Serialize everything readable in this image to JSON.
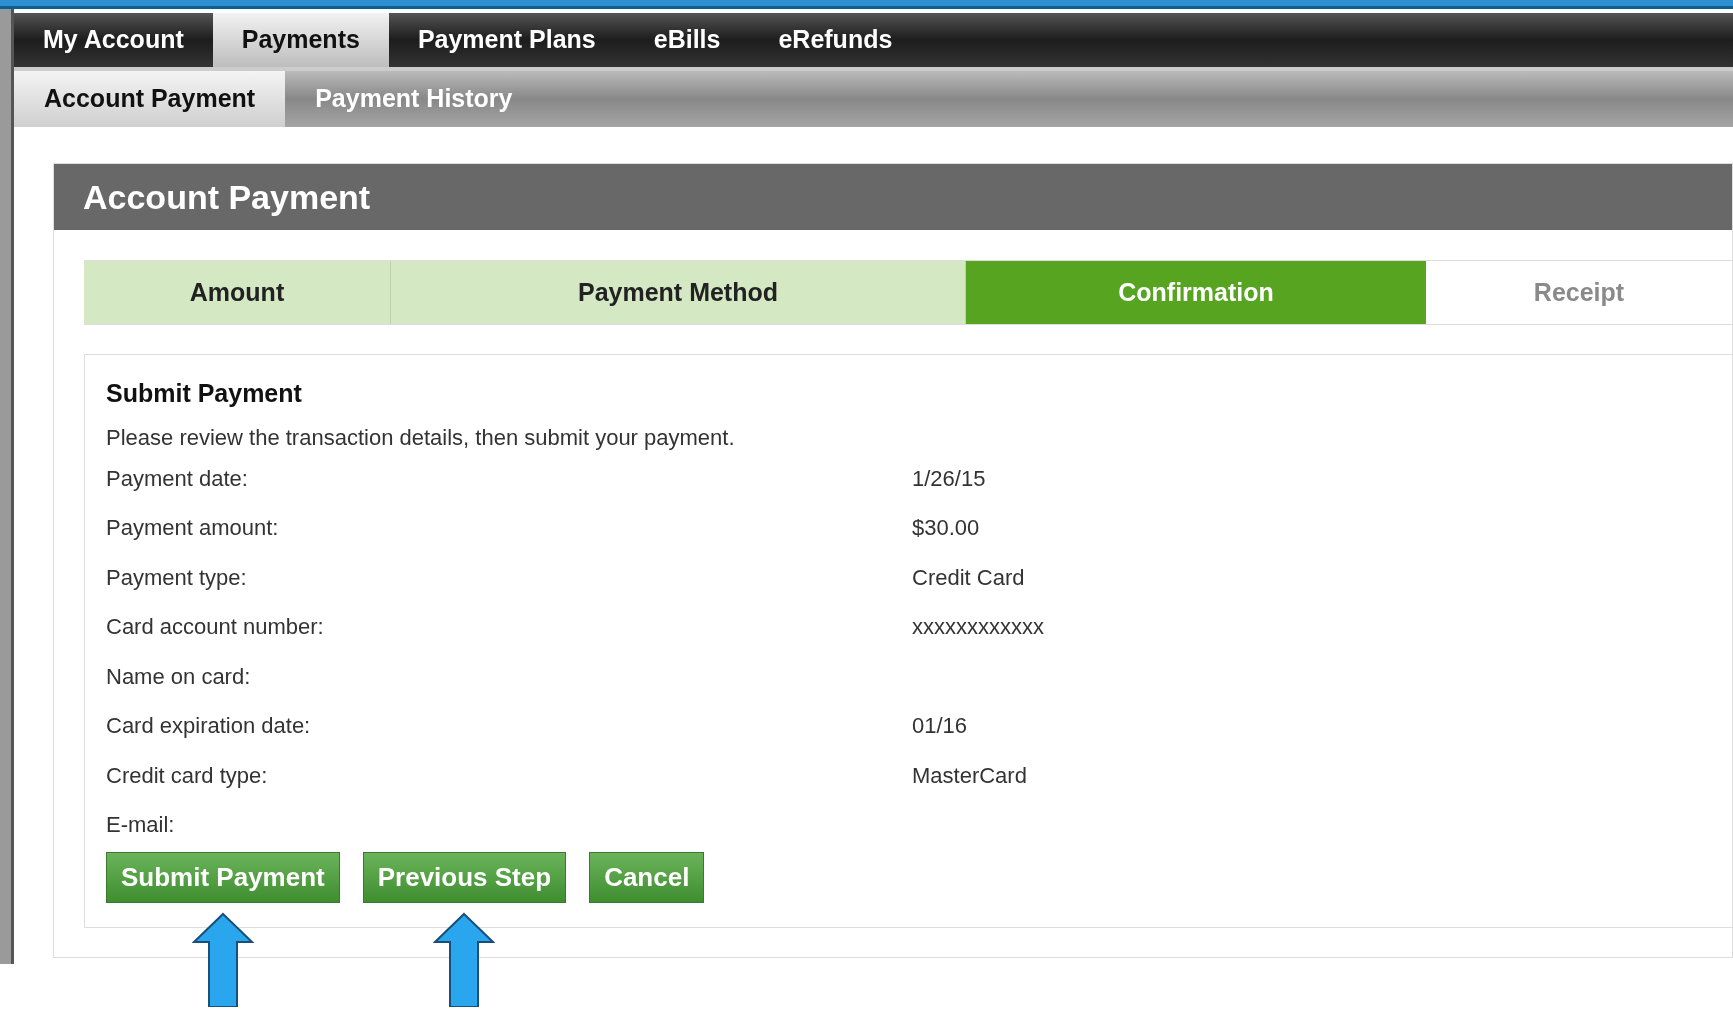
{
  "nav": [
    {
      "label": "My Account",
      "selected": false
    },
    {
      "label": "Payments",
      "selected": true
    },
    {
      "label": "Payment Plans",
      "selected": false
    },
    {
      "label": "eBills",
      "selected": false
    },
    {
      "label": "eRefunds",
      "selected": false
    }
  ],
  "subnav": [
    {
      "label": "Account Payment",
      "selected": true
    },
    {
      "label": "Payment History",
      "selected": false
    }
  ],
  "panel": {
    "title": "Account Payment",
    "steps": [
      {
        "label": "Amount",
        "completed": true,
        "selected": false
      },
      {
        "label": "Payment Method",
        "completed": true,
        "selected": false
      },
      {
        "label": "Confirmation",
        "completed": false,
        "selected": true
      },
      {
        "label": "Receipt",
        "completed": false,
        "selected": false
      }
    ],
    "heading": "Submit Payment",
    "intro": "Please review the transaction details, then submit your payment.",
    "details": [
      {
        "label": "Payment date:",
        "value": "1/26/15"
      },
      {
        "label": "Payment amount:",
        "value": "$30.00"
      },
      {
        "label": "Payment type:",
        "value": "Credit Card"
      },
      {
        "label": "Card account number:",
        "value": "xxxxxxxxxxxx"
      },
      {
        "label": "Name on card:"
      },
      {
        "label": "Card expiration date:",
        "value": "01/16"
      },
      {
        "label": "Credit card type:",
        "value": "MasterCard"
      },
      {
        "label": "E-mail:"
      }
    ],
    "buttons": [
      {
        "label": "Submit Payment",
        "pointed": true
      },
      {
        "label": "Previous Step",
        "pointed": true
      },
      {
        "label": "Cancel",
        "pointed": false
      }
    ]
  }
}
